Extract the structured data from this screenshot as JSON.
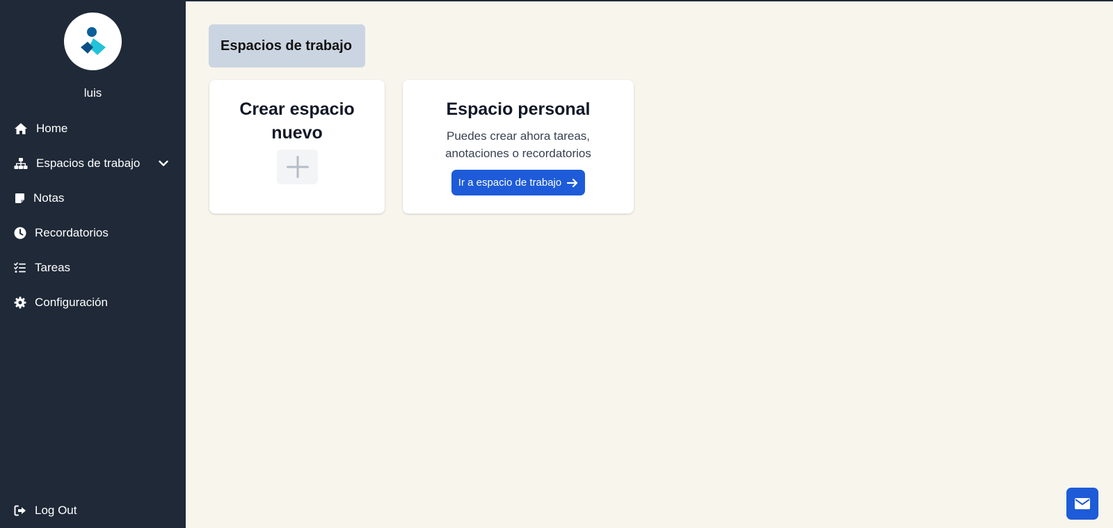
{
  "user": {
    "name": "luis"
  },
  "nav": {
    "home": "Home",
    "workspaces": "Espacios de trabajo",
    "notes": "Notas",
    "reminders": "Recordatorios",
    "tasks": "Tareas",
    "settings": "Configuración",
    "logout": "Log Out"
  },
  "main": {
    "header": "Espacios de trabajo",
    "create_card": {
      "title": "Crear espacio nuevo"
    },
    "personal_card": {
      "title": "Espacio personal",
      "description": "Puedes crear ahora tareas, anotaciones o recordatorios",
      "button_label": "Ir a espacio de trabajo"
    }
  },
  "icons": {
    "logo": "user-logo-icon",
    "home": "home-icon",
    "workspaces": "sitemap-icon",
    "notes": "sticky-note-icon",
    "reminders": "clock-icon",
    "tasks": "task-list-icon",
    "settings": "gear-icon",
    "logout": "logout-icon",
    "plus": "plus-icon",
    "arrow": "arrow-right-icon",
    "mail": "mail-icon"
  },
  "colors": {
    "sidebar": "#1f2937",
    "background": "#f8f5ed",
    "accent": "#1d5bd8",
    "header_bg": "#cbd5e1"
  }
}
